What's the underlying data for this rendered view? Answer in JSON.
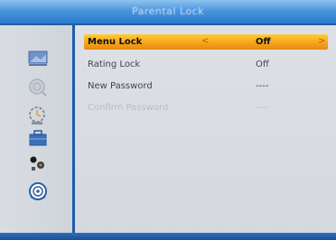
{
  "title": "Parental Lock",
  "menu": {
    "items": [
      {
        "label": "Menu Lock",
        "value": "Off",
        "arrow_left": "<",
        "arrow_right": ">"
      },
      {
        "label": "Rating Lock",
        "value": "Off"
      },
      {
        "label": "New Password",
        "value": "----"
      },
      {
        "label": "Confirm Password",
        "value": "----"
      }
    ]
  },
  "sidebar": {
    "icons": [
      "picture-icon",
      "search-icon",
      "time-icon",
      "toolbox-icon",
      "system-icon",
      "media-icon"
    ]
  },
  "colors": {
    "title_bar": "#4a95dd",
    "highlight": "#f7a11a",
    "divider": "#1f5aa8"
  }
}
